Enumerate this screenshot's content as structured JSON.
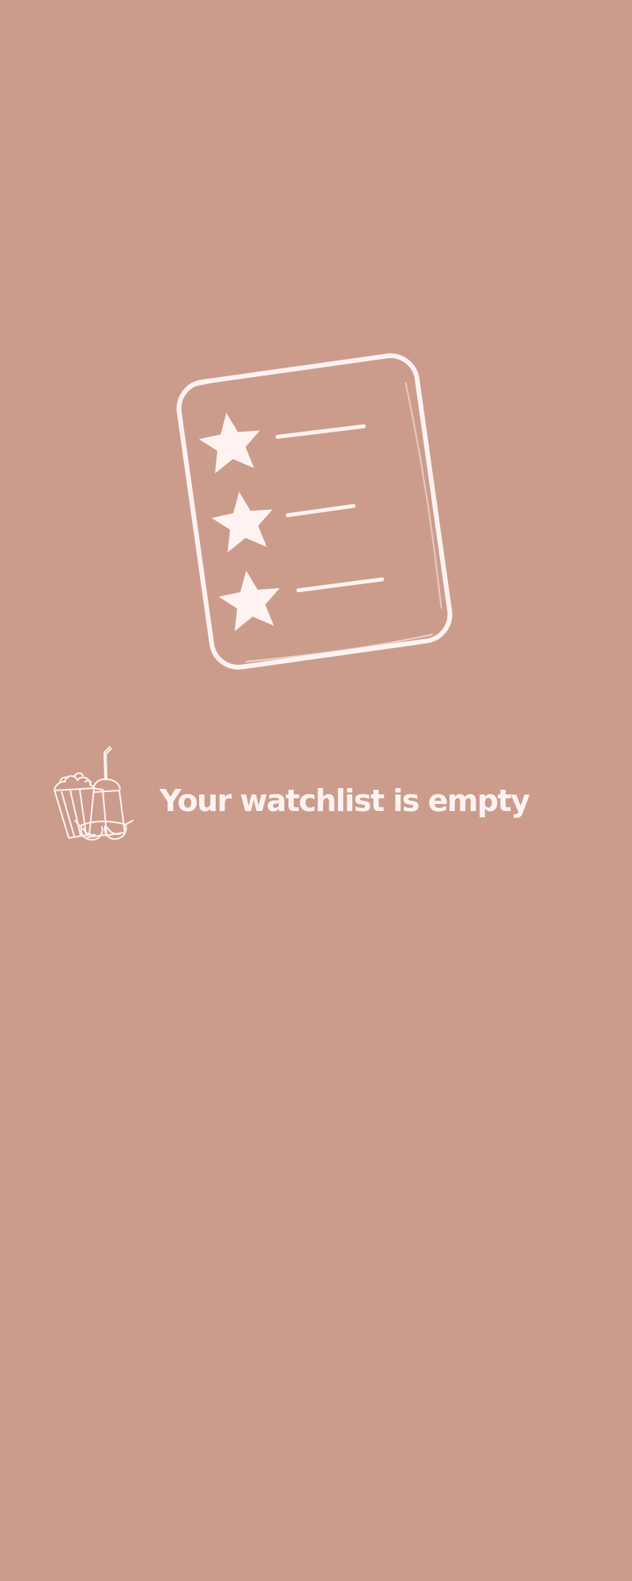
{
  "colors": {
    "background": "#cb9b8c",
    "foreground": "#fff3f1"
  },
  "empty_state": {
    "title": "Your watchlist is empty",
    "illustration_icon": "watchlist-star-list-icon",
    "snack_icon": "popcorn-drink-3d-glasses-icon"
  }
}
